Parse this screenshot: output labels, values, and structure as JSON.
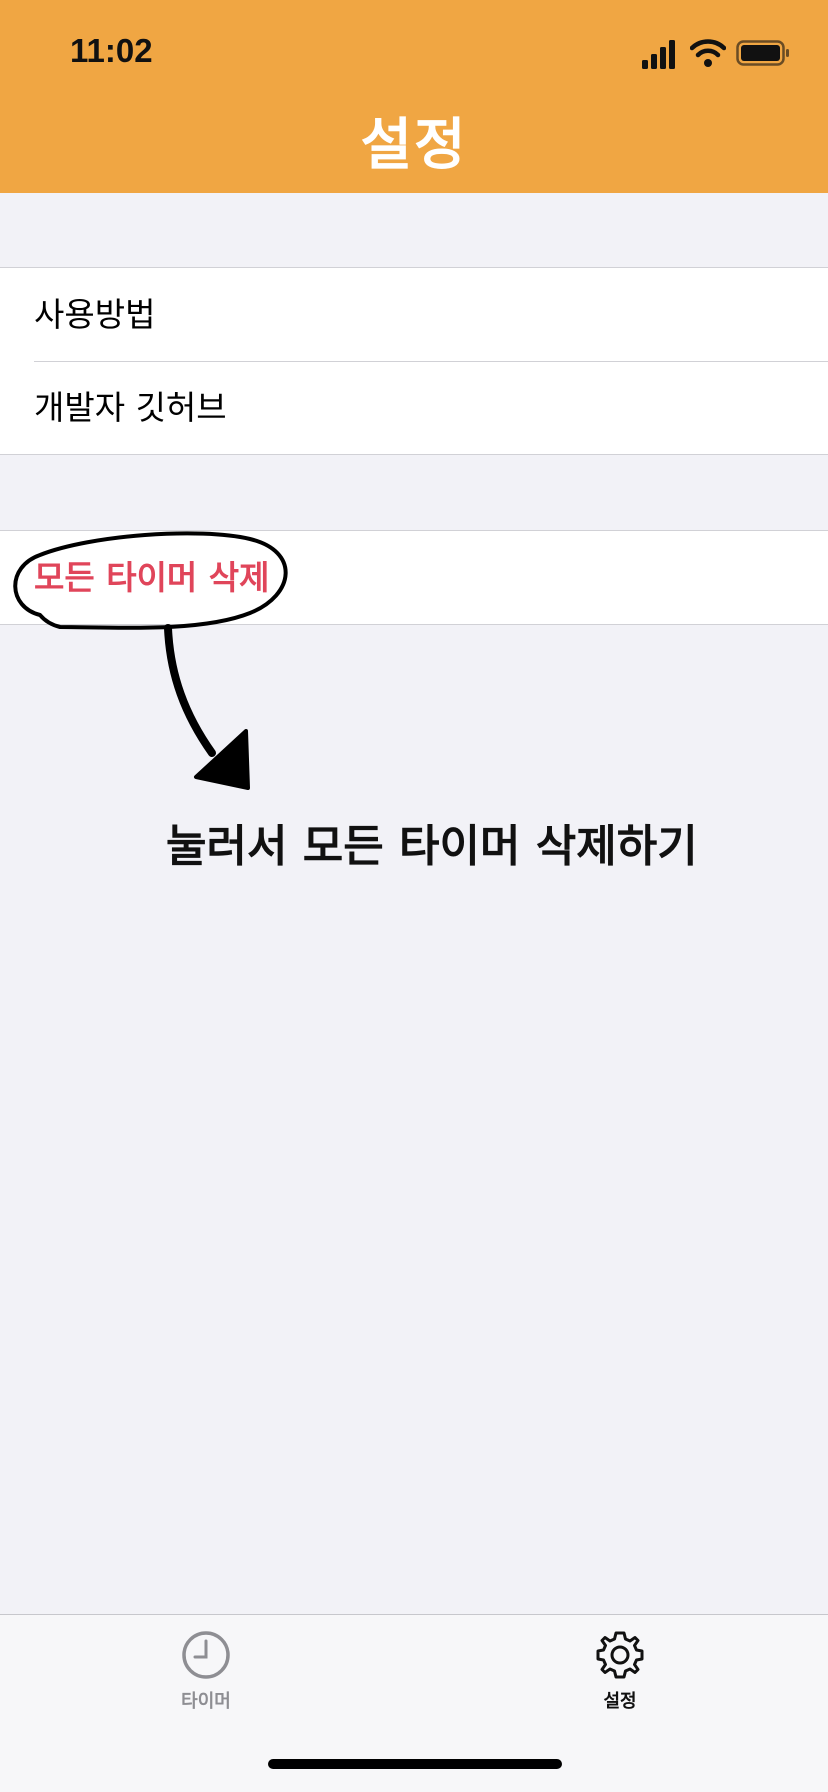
{
  "status_bar": {
    "time": "11:02",
    "icons": [
      "signal-icon",
      "wifi-icon",
      "battery-icon"
    ]
  },
  "nav": {
    "title": "설정"
  },
  "settings": {
    "group1": [
      {
        "label": "사용방법"
      },
      {
        "label": "개발자 깃허브"
      }
    ],
    "group2": [
      {
        "label": "모든 타이머 삭제",
        "color": "#e0455a"
      }
    ]
  },
  "annotation": {
    "text": "눌러서 모든 타이머 삭제하기"
  },
  "tabbar": {
    "tabs": [
      {
        "label": "타이머",
        "icon": "clock-icon",
        "selected": false
      },
      {
        "label": "설정",
        "icon": "gear-icon",
        "selected": true
      }
    ]
  },
  "colors": {
    "header": "#f0a643",
    "background": "#f2f2f7",
    "danger": "#e0455a"
  }
}
